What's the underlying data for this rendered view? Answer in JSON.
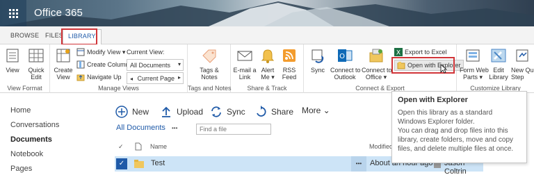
{
  "suite": {
    "app_name": "Office 365"
  },
  "tabs": {
    "browse": "BROWSE",
    "files": "FILES",
    "library": "LIBRARY"
  },
  "ribbon": {
    "view_format": {
      "view": "View",
      "quick_edit": "Quick\nEdit",
      "label": "View Format"
    },
    "manage_views": {
      "create_view": "Create\nView",
      "modify_view": "Modify View ▾",
      "create_column": "Create Column",
      "navigate_up": "Navigate Up",
      "current_view_label": "Current View:",
      "current_view_value": "All Documents",
      "current_page": "Current Page",
      "label": "Manage Views"
    },
    "tags_notes": {
      "btn": "Tags &\nNotes",
      "label": "Tags and Notes"
    },
    "share_track": {
      "email": "E-mail a\nLink",
      "alert": "Alert\nMe ▾",
      "rss": "RSS\nFeed",
      "label": "Share & Track"
    },
    "connect_export": {
      "sync": "Sync",
      "outlook": "Connect to\nOutlook",
      "office": "Connect to\nOffice ▾",
      "export_excel": "Export to Excel",
      "open_explorer": "Open with Explorer",
      "label": "Connect & Export"
    },
    "customize": {
      "form_web_parts": "Form Web\nParts ▾",
      "edit_library": "Edit\nLibrary",
      "new_quick_step": "New Qui\nStep",
      "label": "Customize Library"
    }
  },
  "leftnav": [
    "Home",
    "Conversations",
    "Documents",
    "Notebook",
    "Pages"
  ],
  "commands": {
    "new": "New",
    "upload": "Upload",
    "sync": "Sync",
    "share": "Share",
    "more": "More ⌄"
  },
  "view": {
    "all_documents": "All Documents",
    "ellipsis": "•••",
    "search_placeholder": "Find a file"
  },
  "list": {
    "header_name": "Name",
    "header_modified": "Modified",
    "rows": [
      {
        "name": "Test",
        "modified": "About an hour ago",
        "modified_by": "Jason Coltrin",
        "more": "•••"
      }
    ]
  },
  "tooltip": {
    "title": "Open with Explorer",
    "line1": "Open this library as a standard Windows Explorer folder.",
    "line2": "You can drag and drop files into this library, create folders, move and copy files, and delete multiple files at once."
  },
  "colors": {
    "accent": "#1f5aa8",
    "highlight": "#d13438",
    "selected_row": "#cde4f7"
  }
}
